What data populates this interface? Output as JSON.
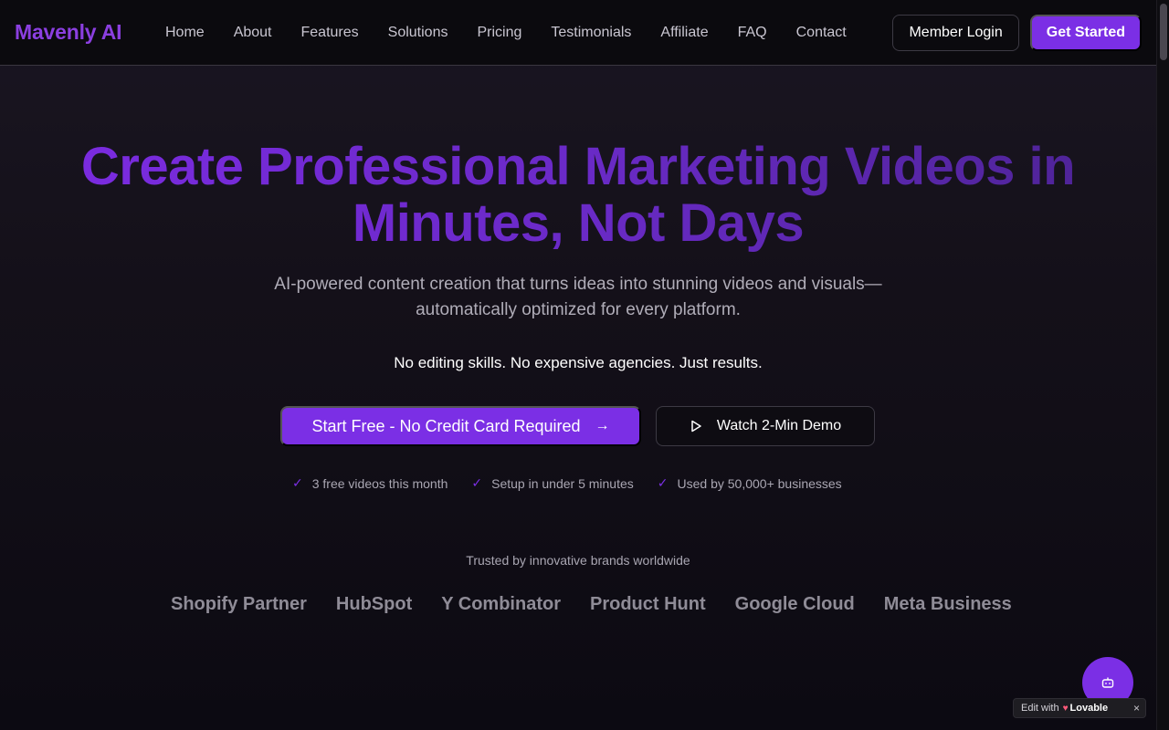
{
  "nav": {
    "logo": "Mavenly AI",
    "links": [
      "Home",
      "About",
      "Features",
      "Solutions",
      "Pricing",
      "Testimonials",
      "Affiliate",
      "FAQ",
      "Contact"
    ],
    "login_label": "Member Login",
    "get_started_label": "Get Started"
  },
  "hero": {
    "title_line1": "Create Professional Marketing Videos in",
    "title_line2": "Minutes, Not Days",
    "subtitle": "AI-powered content creation that turns ideas into stunning videos and visuals—automatically optimized for every platform.",
    "tagline": "No editing skills. No expensive agencies. Just results.",
    "primary_cta": "Start Free - No Credit Card Required",
    "demo_cta": "Watch 2-Min Demo",
    "checks": [
      "3 free videos this month",
      "Setup in under 5 minutes",
      "Used by 50,000+ businesses"
    ]
  },
  "trust": {
    "label": "Trusted by innovative brands worldwide",
    "brands": [
      "Shopify Partner",
      "HubSpot",
      "Y Combinator",
      "Product Hunt",
      "Google Cloud",
      "Meta Business"
    ]
  },
  "badge": {
    "prefix": "Edit with",
    "brand": "Lovable",
    "close": "×"
  },
  "colors": {
    "accent": "#7b2fe5",
    "background": "#0c0a12"
  }
}
